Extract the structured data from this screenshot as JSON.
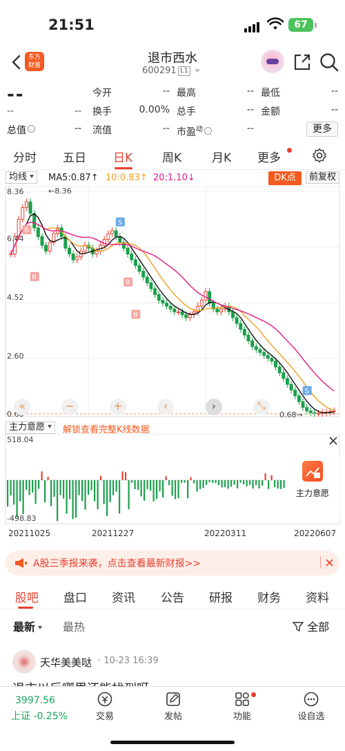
{
  "status": {
    "time": "21:51",
    "battery": "67"
  },
  "header": {
    "logo_line1": "东方",
    "logo_line2": "财富",
    "stock_name": "退市西水",
    "stock_code": "600291",
    "level": "L1"
  },
  "quote": {
    "price": "--",
    "change1": "--",
    "change2": "--",
    "rows": [
      [
        {
          "label": "今开",
          "value": "--"
        },
        {
          "label": "最高",
          "value": "--"
        },
        {
          "label": "最低",
          "value": "--"
        }
      ],
      [
        {
          "label": "换手",
          "value": "0.00%"
        },
        {
          "label": "总手",
          "value": "--"
        },
        {
          "label": "金额",
          "value": "--"
        }
      ],
      [
        {
          "label": "流值",
          "value": "--"
        },
        {
          "label": "市盈",
          "value": "--"
        }
      ]
    ],
    "total_value_label": "总值",
    "total_value": "--",
    "pe_sup": "动",
    "more": "更多"
  },
  "period_tabs": [
    "分时",
    "五日",
    "日K",
    "周K",
    "月K",
    "更多"
  ],
  "indicator": {
    "ma_select": "均线",
    "ma5": "MA5:0.87↑",
    "ma10": "10:0.83↑",
    "ma20": "20:1.10↓",
    "dk": "DK点",
    "adjust": "前复权"
  },
  "chart_data": {
    "type": "candlestick",
    "y_ticks": [
      "8.36",
      "6.44",
      "4.52",
      "2.60",
      "0.68"
    ],
    "high_label": "8.36",
    "low_label": "0.68",
    "ylim": [
      0.68,
      8.36
    ],
    "x_ticks": [
      "20211025",
      "20211227",
      "20220311",
      "20220607"
    ],
    "close_series": [
      6.2,
      6.8,
      7.4,
      7.8,
      8.0,
      7.6,
      7.1,
      6.8,
      6.5,
      6.3,
      6.6,
      6.9,
      7.1,
      6.8,
      6.4,
      6.2,
      6.0,
      6.1,
      6.3,
      6.5,
      6.4,
      6.2,
      6.3,
      6.5,
      6.7,
      6.9,
      7.0,
      6.8,
      6.6,
      6.4,
      6.2,
      6.0,
      5.8,
      5.6,
      5.4,
      5.2,
      5.0,
      4.8,
      4.6,
      4.5,
      4.4,
      4.3,
      4.2,
      4.2,
      4.1,
      4.0,
      4.1,
      4.2,
      4.4,
      4.6,
      4.9,
      4.5,
      4.3,
      4.2,
      4.3,
      4.4,
      4.2,
      4.0,
      3.8,
      3.6,
      3.4,
      3.2,
      3.0,
      2.9,
      2.8,
      2.7,
      2.6,
      2.5,
      2.3,
      2.1,
      1.9,
      1.7,
      1.5,
      1.3,
      1.1,
      0.9,
      0.78,
      0.72,
      0.7,
      0.7,
      0.72,
      0.74,
      0.76,
      0.78
    ],
    "markers": [
      {
        "type": "B",
        "text": "B"
      },
      {
        "type": "B",
        "text": "B"
      },
      {
        "type": "B",
        "text": "B"
      },
      {
        "type": "B",
        "text": "B"
      },
      {
        "type": "S",
        "text": "S"
      },
      {
        "type": "S",
        "text": "S"
      }
    ],
    "sub_indicator": {
      "name": "主力意愿",
      "ylim": [
        -498.83,
        518.04
      ],
      "max_label": "518.04",
      "min_label": "-498.83"
    }
  },
  "chart_controls": [
    "«",
    "−",
    "+",
    "‹",
    "›",
    "⤡"
  ],
  "sub": {
    "select": "主力意愿",
    "unlock": "解锁查看完整K线数据",
    "lock_card_label": "主力意愿"
  },
  "notice": {
    "text": "A股三季报来袭，点击查看最新财报>>"
  },
  "news_tabs": [
    "股吧",
    "盘口",
    "资讯",
    "公告",
    "研报",
    "财务",
    "资料"
  ],
  "sub_tabs": {
    "latest": "最新",
    "hot": "最热",
    "filter": "全部"
  },
  "post": {
    "author": "天华美美哒",
    "time": "· 10-23 16:39",
    "text": "退市以后哪里还能找到呀"
  },
  "bottom": {
    "index_value": "3997.56",
    "index_name": "上证",
    "index_change": "-0.25%",
    "items": [
      "交易",
      "发帖",
      "功能",
      "设自选"
    ]
  }
}
